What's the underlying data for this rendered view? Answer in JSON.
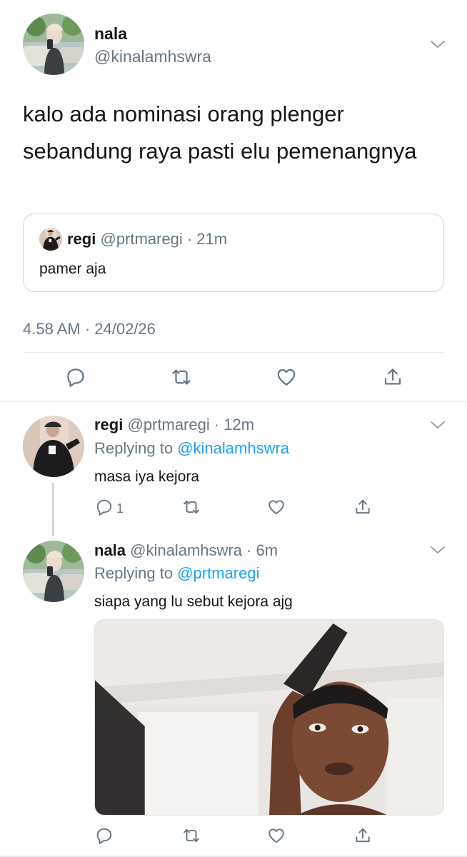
{
  "main_tweet": {
    "author_name": "nala",
    "author_handle": "@kinalamhswra",
    "text": "kalo ada nominasi orang plenger sebandung raya pasti elu pemenangnya",
    "timestamp": "4.58 AM · 24/02/26",
    "quoted": {
      "author_name": "regi",
      "author_meta": "@prtmaregi · 21m",
      "text": "pamer aja"
    },
    "actions": [
      "reply-icon",
      "retweet-icon",
      "like-icon",
      "share-icon"
    ]
  },
  "replies": [
    {
      "author_name": "regi",
      "author_meta": "@prtmaregi · 12m",
      "replying_prefix": "Replying to",
      "replying_handle": "@kinalamhswra",
      "text": "masa iya kejora",
      "reply_count": "1",
      "actions": [
        "reply-icon",
        "retweet-icon",
        "like-icon",
        "share-icon"
      ]
    },
    {
      "author_name": "nala",
      "author_meta": "@kinalamhswra · 6m",
      "replying_prefix": "Replying to",
      "replying_handle": "@prtmaregi",
      "text": "siapa yang lu sebut kejora ajg",
      "media": "photo",
      "actions": [
        "reply-icon",
        "retweet-icon",
        "like-icon",
        "share-icon"
      ]
    }
  ],
  "colors": {
    "link": "#1da1f2",
    "muted": "#657786",
    "text": "#14171a",
    "border": "#ccd6dd"
  }
}
